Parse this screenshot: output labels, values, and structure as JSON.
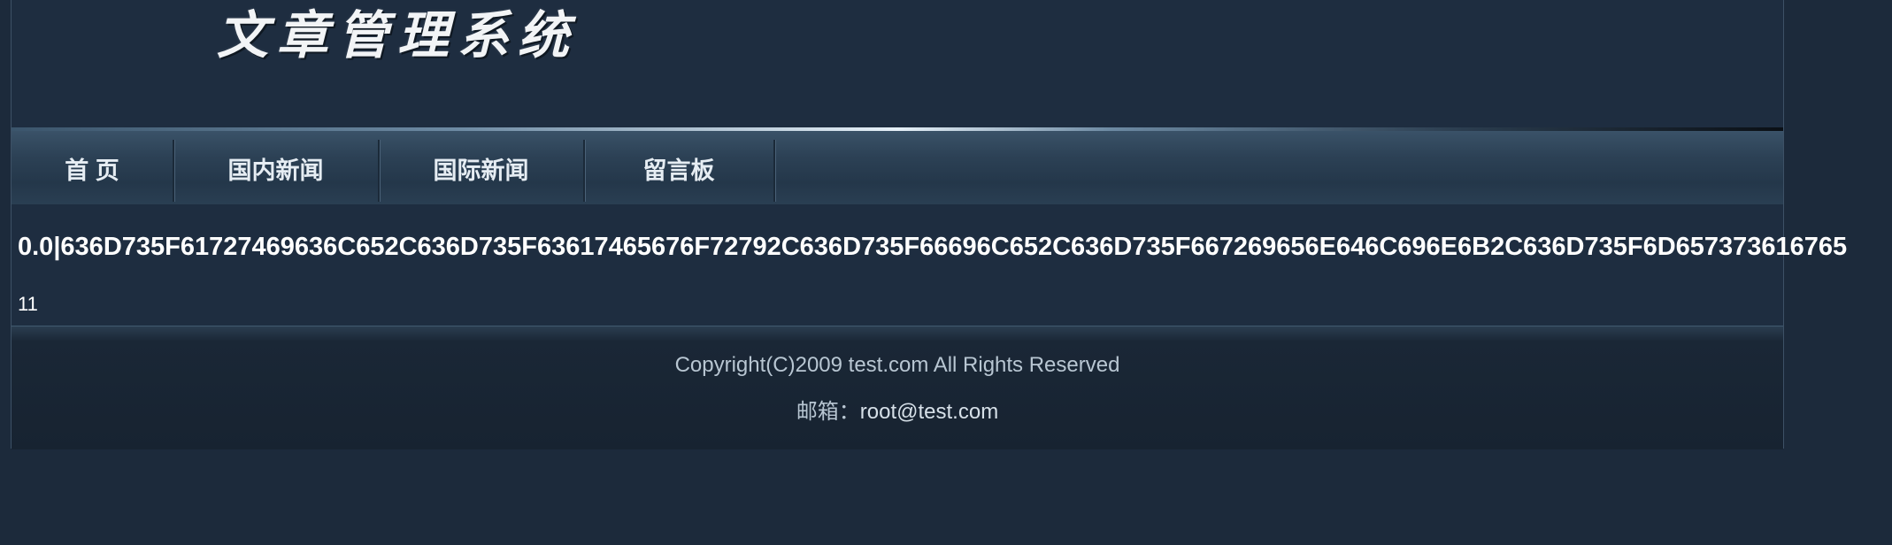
{
  "header": {
    "logo_text": "文章管理系统"
  },
  "nav": {
    "items": [
      {
        "label": "首 页"
      },
      {
        "label": "国内新闻"
      },
      {
        "label": "国际新闻"
      },
      {
        "label": "留言板"
      }
    ]
  },
  "content": {
    "hex_line": "0.0|636D735F61727469636C652C636D735F63617465676F72792C636D735F66696C652C636D735F667269656E646C696E6B2C636D735F6D657373616765",
    "count": "11"
  },
  "footer": {
    "copyright": "Copyright(C)2009 test.com All Rights Reserved",
    "email_label": "邮箱：",
    "email_value": "root@test.com"
  },
  "colors": {
    "background": "#1c2a3b",
    "nav_text": "#e6edf3",
    "footer_text": "#b8c6d2"
  }
}
